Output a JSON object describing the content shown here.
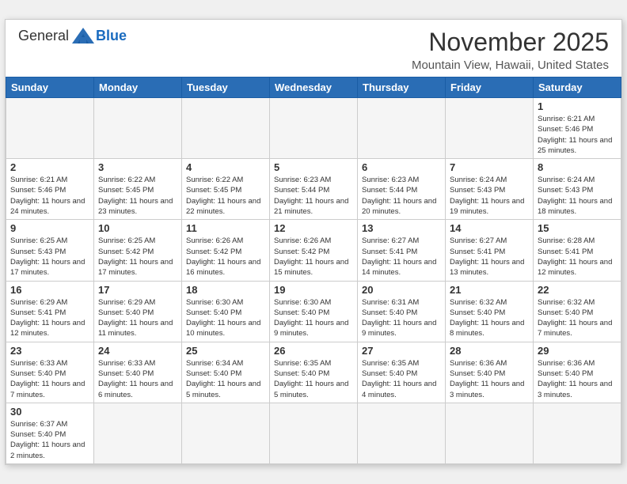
{
  "header": {
    "logo_general": "General",
    "logo_blue": "Blue",
    "month": "November 2025",
    "location": "Mountain View, Hawaii, United States"
  },
  "weekdays": [
    "Sunday",
    "Monday",
    "Tuesday",
    "Wednesday",
    "Thursday",
    "Friday",
    "Saturday"
  ],
  "weeks": [
    [
      {
        "day": "",
        "info": ""
      },
      {
        "day": "",
        "info": ""
      },
      {
        "day": "",
        "info": ""
      },
      {
        "day": "",
        "info": ""
      },
      {
        "day": "",
        "info": ""
      },
      {
        "day": "",
        "info": ""
      },
      {
        "day": "1",
        "info": "Sunrise: 6:21 AM\nSunset: 5:46 PM\nDaylight: 11 hours\nand 25 minutes."
      }
    ],
    [
      {
        "day": "2",
        "info": "Sunrise: 6:21 AM\nSunset: 5:46 PM\nDaylight: 11 hours\nand 24 minutes."
      },
      {
        "day": "3",
        "info": "Sunrise: 6:22 AM\nSunset: 5:45 PM\nDaylight: 11 hours\nand 23 minutes."
      },
      {
        "day": "4",
        "info": "Sunrise: 6:22 AM\nSunset: 5:45 PM\nDaylight: 11 hours\nand 22 minutes."
      },
      {
        "day": "5",
        "info": "Sunrise: 6:23 AM\nSunset: 5:44 PM\nDaylight: 11 hours\nand 21 minutes."
      },
      {
        "day": "6",
        "info": "Sunrise: 6:23 AM\nSunset: 5:44 PM\nDaylight: 11 hours\nand 20 minutes."
      },
      {
        "day": "7",
        "info": "Sunrise: 6:24 AM\nSunset: 5:43 PM\nDaylight: 11 hours\nand 19 minutes."
      },
      {
        "day": "8",
        "info": "Sunrise: 6:24 AM\nSunset: 5:43 PM\nDaylight: 11 hours\nand 18 minutes."
      }
    ],
    [
      {
        "day": "9",
        "info": "Sunrise: 6:25 AM\nSunset: 5:43 PM\nDaylight: 11 hours\nand 17 minutes."
      },
      {
        "day": "10",
        "info": "Sunrise: 6:25 AM\nSunset: 5:42 PM\nDaylight: 11 hours\nand 17 minutes."
      },
      {
        "day": "11",
        "info": "Sunrise: 6:26 AM\nSunset: 5:42 PM\nDaylight: 11 hours\nand 16 minutes."
      },
      {
        "day": "12",
        "info": "Sunrise: 6:26 AM\nSunset: 5:42 PM\nDaylight: 11 hours\nand 15 minutes."
      },
      {
        "day": "13",
        "info": "Sunrise: 6:27 AM\nSunset: 5:41 PM\nDaylight: 11 hours\nand 14 minutes."
      },
      {
        "day": "14",
        "info": "Sunrise: 6:27 AM\nSunset: 5:41 PM\nDaylight: 11 hours\nand 13 minutes."
      },
      {
        "day": "15",
        "info": "Sunrise: 6:28 AM\nSunset: 5:41 PM\nDaylight: 11 hours\nand 12 minutes."
      }
    ],
    [
      {
        "day": "16",
        "info": "Sunrise: 6:29 AM\nSunset: 5:41 PM\nDaylight: 11 hours\nand 12 minutes."
      },
      {
        "day": "17",
        "info": "Sunrise: 6:29 AM\nSunset: 5:40 PM\nDaylight: 11 hours\nand 11 minutes."
      },
      {
        "day": "18",
        "info": "Sunrise: 6:30 AM\nSunset: 5:40 PM\nDaylight: 11 hours\nand 10 minutes."
      },
      {
        "day": "19",
        "info": "Sunrise: 6:30 AM\nSunset: 5:40 PM\nDaylight: 11 hours\nand 9 minutes."
      },
      {
        "day": "20",
        "info": "Sunrise: 6:31 AM\nSunset: 5:40 PM\nDaylight: 11 hours\nand 9 minutes."
      },
      {
        "day": "21",
        "info": "Sunrise: 6:32 AM\nSunset: 5:40 PM\nDaylight: 11 hours\nand 8 minutes."
      },
      {
        "day": "22",
        "info": "Sunrise: 6:32 AM\nSunset: 5:40 PM\nDaylight: 11 hours\nand 7 minutes."
      }
    ],
    [
      {
        "day": "23",
        "info": "Sunrise: 6:33 AM\nSunset: 5:40 PM\nDaylight: 11 hours\nand 7 minutes."
      },
      {
        "day": "24",
        "info": "Sunrise: 6:33 AM\nSunset: 5:40 PM\nDaylight: 11 hours\nand 6 minutes."
      },
      {
        "day": "25",
        "info": "Sunrise: 6:34 AM\nSunset: 5:40 PM\nDaylight: 11 hours\nand 5 minutes."
      },
      {
        "day": "26",
        "info": "Sunrise: 6:35 AM\nSunset: 5:40 PM\nDaylight: 11 hours\nand 5 minutes."
      },
      {
        "day": "27",
        "info": "Sunrise: 6:35 AM\nSunset: 5:40 PM\nDaylight: 11 hours\nand 4 minutes."
      },
      {
        "day": "28",
        "info": "Sunrise: 6:36 AM\nSunset: 5:40 PM\nDaylight: 11 hours\nand 3 minutes."
      },
      {
        "day": "29",
        "info": "Sunrise: 6:36 AM\nSunset: 5:40 PM\nDaylight: 11 hours\nand 3 minutes."
      }
    ],
    [
      {
        "day": "30",
        "info": "Sunrise: 6:37 AM\nSunset: 5:40 PM\nDaylight: 11 hours\nand 2 minutes."
      },
      {
        "day": "",
        "info": ""
      },
      {
        "day": "",
        "info": ""
      },
      {
        "day": "",
        "info": ""
      },
      {
        "day": "",
        "info": ""
      },
      {
        "day": "",
        "info": ""
      },
      {
        "day": "",
        "info": ""
      }
    ]
  ]
}
